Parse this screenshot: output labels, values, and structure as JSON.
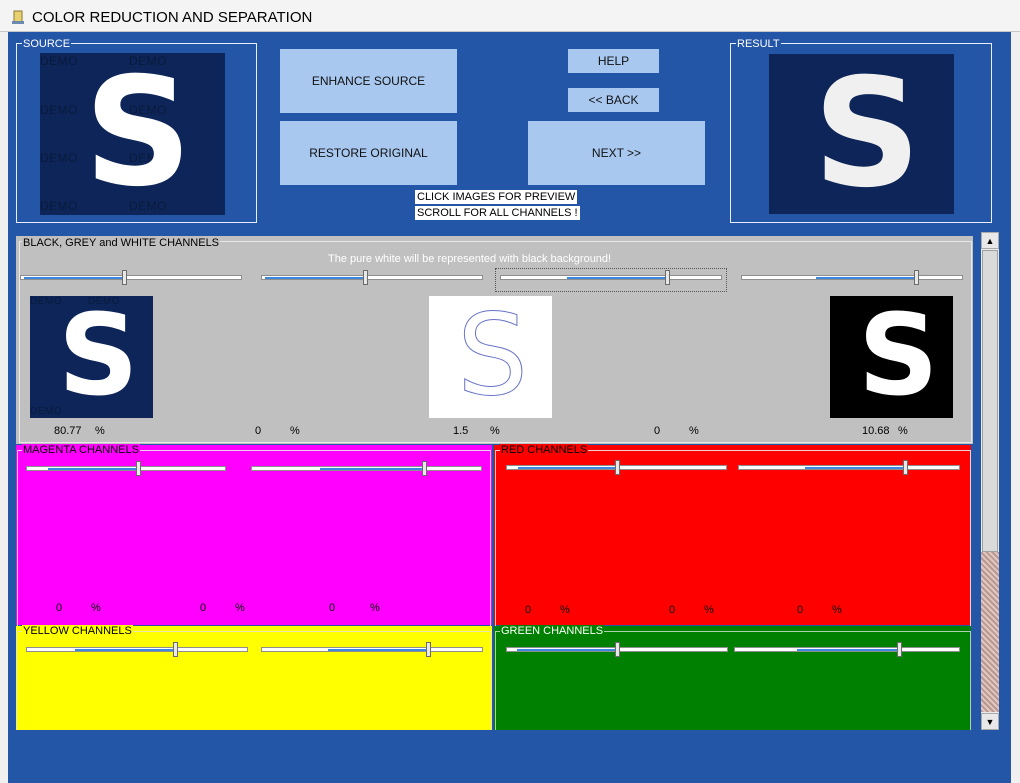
{
  "window": {
    "title": "COLOR REDUCTION AND SEPARATION"
  },
  "source_group": {
    "label": "SOURCE",
    "watermark": "DEMO",
    "glyph": "S"
  },
  "result_group": {
    "label": "RESULT",
    "glyph": "S"
  },
  "buttons": {
    "enhance": "ENHANCE SOURCE",
    "restore": "RESTORE ORIGINAL",
    "help": "HELP",
    "back": "<< BACK",
    "next": "NEXT >>"
  },
  "notes": [
    "CLICK IMAGES FOR PREVIEW",
    "SCROLL FOR ALL CHANNELS !"
  ],
  "bgw": {
    "label": "BLACK, GREY and WHITE CHANNELS",
    "message": "The pure white will be represented with black background!",
    "percentages": [
      "80.77",
      "0",
      "1.5",
      "0",
      "10.68"
    ],
    "percent_sign": "%",
    "slider_values": [
      0.47,
      0.47,
      0.75,
      0.79
    ]
  },
  "magenta": {
    "label": "MAGENTA CHANNELS",
    "percentages": [
      "0",
      "0",
      "0"
    ],
    "slider_values": [
      0.56,
      0.75
    ],
    "color": "#ff00ff"
  },
  "red": {
    "label": "RED CHANNELS",
    "percentages": [
      "0",
      "0",
      "0"
    ],
    "slider_values": [
      0.5,
      0.75
    ],
    "color": "#ff0000"
  },
  "yellow": {
    "label": "YELLOW CHANNELS",
    "slider_values": [
      0.67,
      0.75
    ],
    "color": "#ffff00"
  },
  "green": {
    "label": "GREEN CHANNELS",
    "slider_values": [
      0.5,
      0.73
    ],
    "color": "#008000"
  },
  "colors": {
    "client": "#2456a8",
    "button": "#a9c8f0",
    "image_bg": "#0d2558",
    "grey_panel": "#c0c0c0"
  }
}
